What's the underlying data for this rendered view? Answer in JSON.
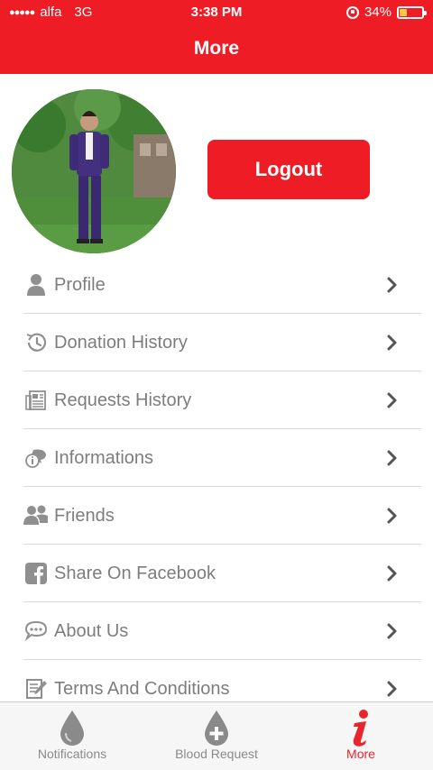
{
  "status_bar": {
    "carrier": "alfa",
    "network": "3G",
    "time": "3:38 PM",
    "battery": "34%",
    "battery_level": 0.34
  },
  "header": {
    "title": "More"
  },
  "profile": {
    "logout_label": "Logout"
  },
  "menu": {
    "items": [
      {
        "label": "Profile",
        "icon": "user-icon"
      },
      {
        "label": "Donation History",
        "icon": "history-icon"
      },
      {
        "label": "Requests History",
        "icon": "newspaper-icon"
      },
      {
        "label": "Informations",
        "icon": "info-chat-icon"
      },
      {
        "label": "Friends",
        "icon": "friends-icon"
      },
      {
        "label": "Share On Facebook",
        "icon": "facebook-icon"
      },
      {
        "label": "About Us",
        "icon": "chat-bubble-icon"
      },
      {
        "label": "Terms And Conditions",
        "icon": "document-icon"
      }
    ]
  },
  "tabbar": {
    "tabs": [
      {
        "label": "Notifications",
        "icon": "drop-icon",
        "active": false
      },
      {
        "label": "Blood Request",
        "icon": "drop-plus-icon",
        "active": false
      },
      {
        "label": "More",
        "icon": "info-icon",
        "active": true
      }
    ]
  },
  "colors": {
    "accent": "#ee1c25",
    "text_gray": "#7d7d7d",
    "icon_gray": "#8f8f8f",
    "divider": "#dadada"
  }
}
